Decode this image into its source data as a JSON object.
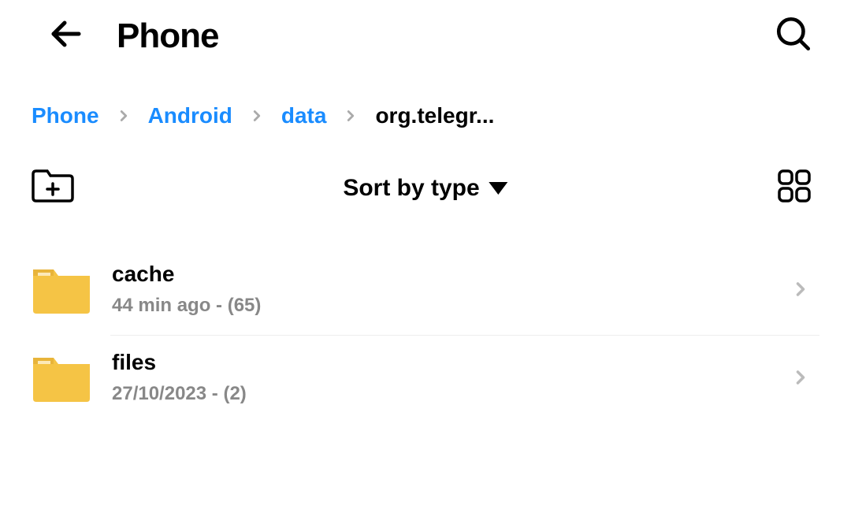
{
  "header": {
    "title": "Phone"
  },
  "breadcrumb": {
    "items": [
      {
        "label": "Phone",
        "current": false
      },
      {
        "label": "Android",
        "current": false
      },
      {
        "label": "data",
        "current": false
      },
      {
        "label": "org.telegr...",
        "current": true
      }
    ]
  },
  "toolbar": {
    "sort_label": "Sort by type"
  },
  "folders": [
    {
      "name": "cache",
      "meta": "44 min ago - (65)"
    },
    {
      "name": "files",
      "meta": "27/10/2023 - (2)"
    }
  ]
}
